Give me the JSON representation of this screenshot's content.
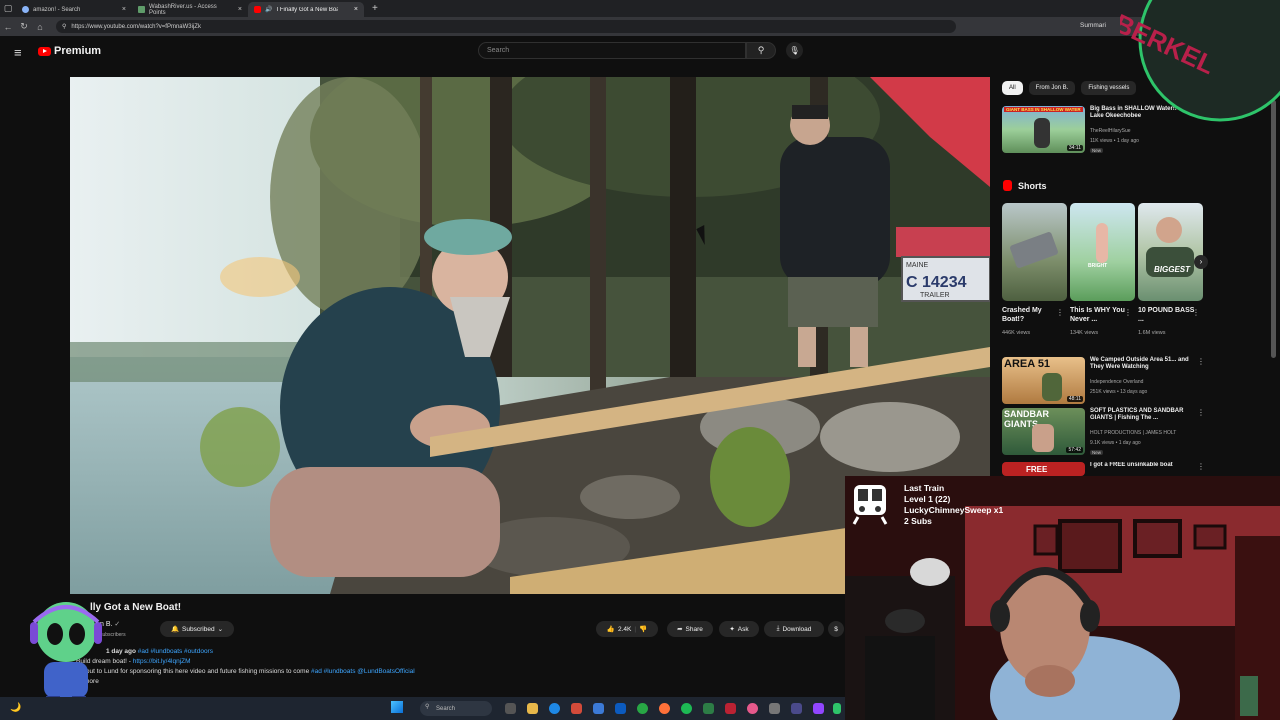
{
  "browser": {
    "tabs": [
      {
        "title": "amazon! - Search",
        "color": "#8ab4f8"
      },
      {
        "title": "WabashRiver.us - Access Points",
        "color": "#5f9c6a"
      },
      {
        "title": "I Finally Got a New Boat! - Yo",
        "color": "#ff0000"
      }
    ],
    "new_tab_label": "+",
    "url": "https://www.youtube.com/watch?v=fPmnaW3ijZk",
    "summary_label": "Summari"
  },
  "youtube": {
    "logo_label": "Premium",
    "search_placeholder": "Search"
  },
  "video": {
    "title": "lly Got a New Boat!",
    "channel_name": "n B.",
    "subscribers": "subscribers",
    "subscribed_label": "Subscribed",
    "likes": "2.4K",
    "share_label": "Share",
    "ask_label": "Ask",
    "download_label": "Download",
    "trailer_plate": "C 14234",
    "trailer_state": "MAINE",
    "trailer_word": "TRAILER"
  },
  "description": {
    "line1_meta": "1 day ago",
    "line1_tags": "#ad #lundboats #outdoors",
    "line2_prefix": "Build",
    "line2_text": "dream boat! -",
    "line2_link": "https://bit.ly/4lqnjZM",
    "line3_text": "shoutout to Lund for sponsoring this here video and future fishing missions to come",
    "line3_tags": "#ad #lundboats @LundBoatsOfficial",
    "more_label": "more"
  },
  "chips": [
    "All",
    "From Jon B.",
    "Fishing vessels"
  ],
  "recommendations_top": [
    {
      "title": "Big Bass in SHALLOW Water!! - Lake Okeechobee",
      "channel": "TheReelHilarySue",
      "meta": "11K views • 1 day ago",
      "badge": "New",
      "duration": "34:11",
      "thumb_text": "GIANT BASS IN SHALLOW WATER"
    }
  ],
  "shorts": {
    "heading": "Shorts",
    "items": [
      {
        "title": "Crashed My Boat!?",
        "views": "446K views",
        "overlay": ""
      },
      {
        "title": "This Is WHY You Never ...",
        "views": "134K views",
        "overlay": "BRIGHT"
      },
      {
        "title": "10 POUND BASS ...",
        "views": "1.6M views",
        "overlay": "BIGGEST"
      }
    ]
  },
  "recommendations_bottom": [
    {
      "title": "We Camped Outside Area 51... and They Were Watching",
      "channel": "Independence Overland",
      "meta": "251K views • 13 days ago",
      "badge": "",
      "duration": "48:11",
      "thumb_text": "AREA 51"
    },
    {
      "title": "SOFT PLASTICS AND SANDBAR GIANTS | Fishing The ...",
      "channel": "HOLT PRODUCTIONS | JAMES HOLT",
      "meta": "9.1K views • 1 day ago",
      "badge": "New",
      "duration": "57:42",
      "thumb_text": "SANDBAR GIANTS"
    },
    {
      "title": "I got a FREE unsinkable boat",
      "channel": "",
      "meta": "",
      "badge": "",
      "duration": "",
      "thumb_text": "FREE"
    }
  ],
  "stream_overlay": {
    "line1": "Last Train",
    "line2": "Level 1  (22)",
    "line3": "LuckyChimneySweep x1",
    "line4": "2 Subs"
  },
  "brand_text": "BERKEL",
  "taskbar": {
    "search_label": "Search"
  },
  "colors": {
    "accent_red": "#ff0000",
    "link_blue": "#3ea6ff",
    "bg": "#0f0f0f"
  }
}
